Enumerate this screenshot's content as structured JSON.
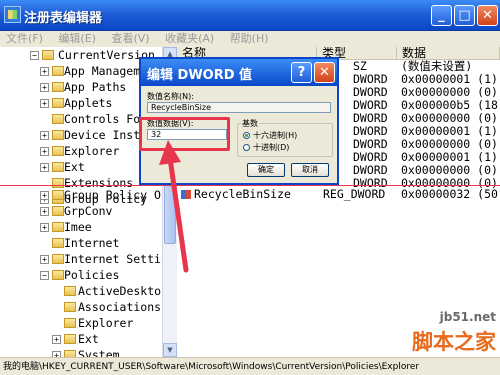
{
  "window": {
    "title": "注册表编辑器",
    "buttons": {
      "minimize": "_",
      "maximize": "□",
      "close": "✕"
    }
  },
  "menu": [
    "文件(F)",
    "编辑(E)",
    "查看(V)",
    "收藏夹(A)",
    "帮助(H)"
  ],
  "tree": [
    {
      "label": "CurrentVersion",
      "expander": "−"
    },
    {
      "label": "App Management",
      "expander": "+"
    },
    {
      "label": "App Paths",
      "expander": "+"
    },
    {
      "label": "Applets",
      "expander": "+"
    },
    {
      "label": "Controls Folder",
      "expander": ""
    },
    {
      "label": "Device Installer",
      "expander": "+"
    },
    {
      "label": "Explorer",
      "expander": "+"
    },
    {
      "label": "Ext",
      "expander": "+"
    },
    {
      "label": "Extensions",
      "expander": ""
    },
    {
      "label": "Group Policy",
      "expander": "+"
    },
    {
      "label": "Group Policy Objects",
      "expander": "+"
    },
    {
      "label": "GrpConv",
      "expander": "+"
    },
    {
      "label": "Imee",
      "expander": "+"
    },
    {
      "label": "Internet",
      "expander": ""
    },
    {
      "label": "Internet Settings",
      "expander": "+"
    },
    {
      "label": "Policies",
      "expander": "−"
    },
    {
      "label": "ActiveDesktop",
      "expander": ""
    },
    {
      "label": "Associations",
      "expander": ""
    },
    {
      "label": "Explorer",
      "expander": ""
    },
    {
      "label": "Ext",
      "expander": "+"
    },
    {
      "label": "System",
      "expander": "+"
    }
  ],
  "list": {
    "headers": [
      "名称",
      "类型",
      "数据"
    ],
    "rows": [
      {
        "name": "",
        "type": "SZ",
        "data": "(数值未设置)"
      },
      {
        "name": "",
        "type": "DWORD",
        "data": "0x00000001 (1)"
      },
      {
        "name": "",
        "type": "DWORD",
        "data": "0x00000000 (0)"
      },
      {
        "name": "",
        "type": "DWORD",
        "data": "0x000000b5 (18"
      },
      {
        "name": "",
        "type": "DWORD",
        "data": "0x00000000 (0)"
      },
      {
        "name": "",
        "type": "DWORD",
        "data": "0x00000001 (1)"
      },
      {
        "name": "",
        "type": "DWORD",
        "data": "0x00000000 (0)"
      },
      {
        "name": "",
        "type": "DWORD",
        "data": "0x00000001 (1)"
      },
      {
        "name": "",
        "type": "DWORD",
        "data": "0x00000000 (0)"
      },
      {
        "name": "",
        "type": "DWORD",
        "data": "0x00000000 (0)"
      },
      {
        "name": "RecycleBinSize",
        "type": "REG_DWORD",
        "data": "0x00000032 (50"
      }
    ]
  },
  "status": "我的电脑\\HKEY_CURRENT_USER\\Software\\Microsoft\\Windows\\CurrentVersion\\Policies\\Explorer",
  "dialog": {
    "title": "编辑 DWORD 值",
    "help": "?",
    "close": "✕",
    "name_label": "数值名称(N):",
    "name_value": "RecycleBinSize",
    "data_label": "数值数据(V):",
    "data_value": "32",
    "base_label": "基数",
    "radio_hex": "十六进制(H)",
    "radio_dec": "十进制(D)",
    "ok": "确定",
    "cancel": "取消"
  },
  "watermark": {
    "site": "jb51.net",
    "name": "脚本之家"
  },
  "colors": {
    "highlight": "#e8354b",
    "titlebar": "#0a47c8"
  }
}
